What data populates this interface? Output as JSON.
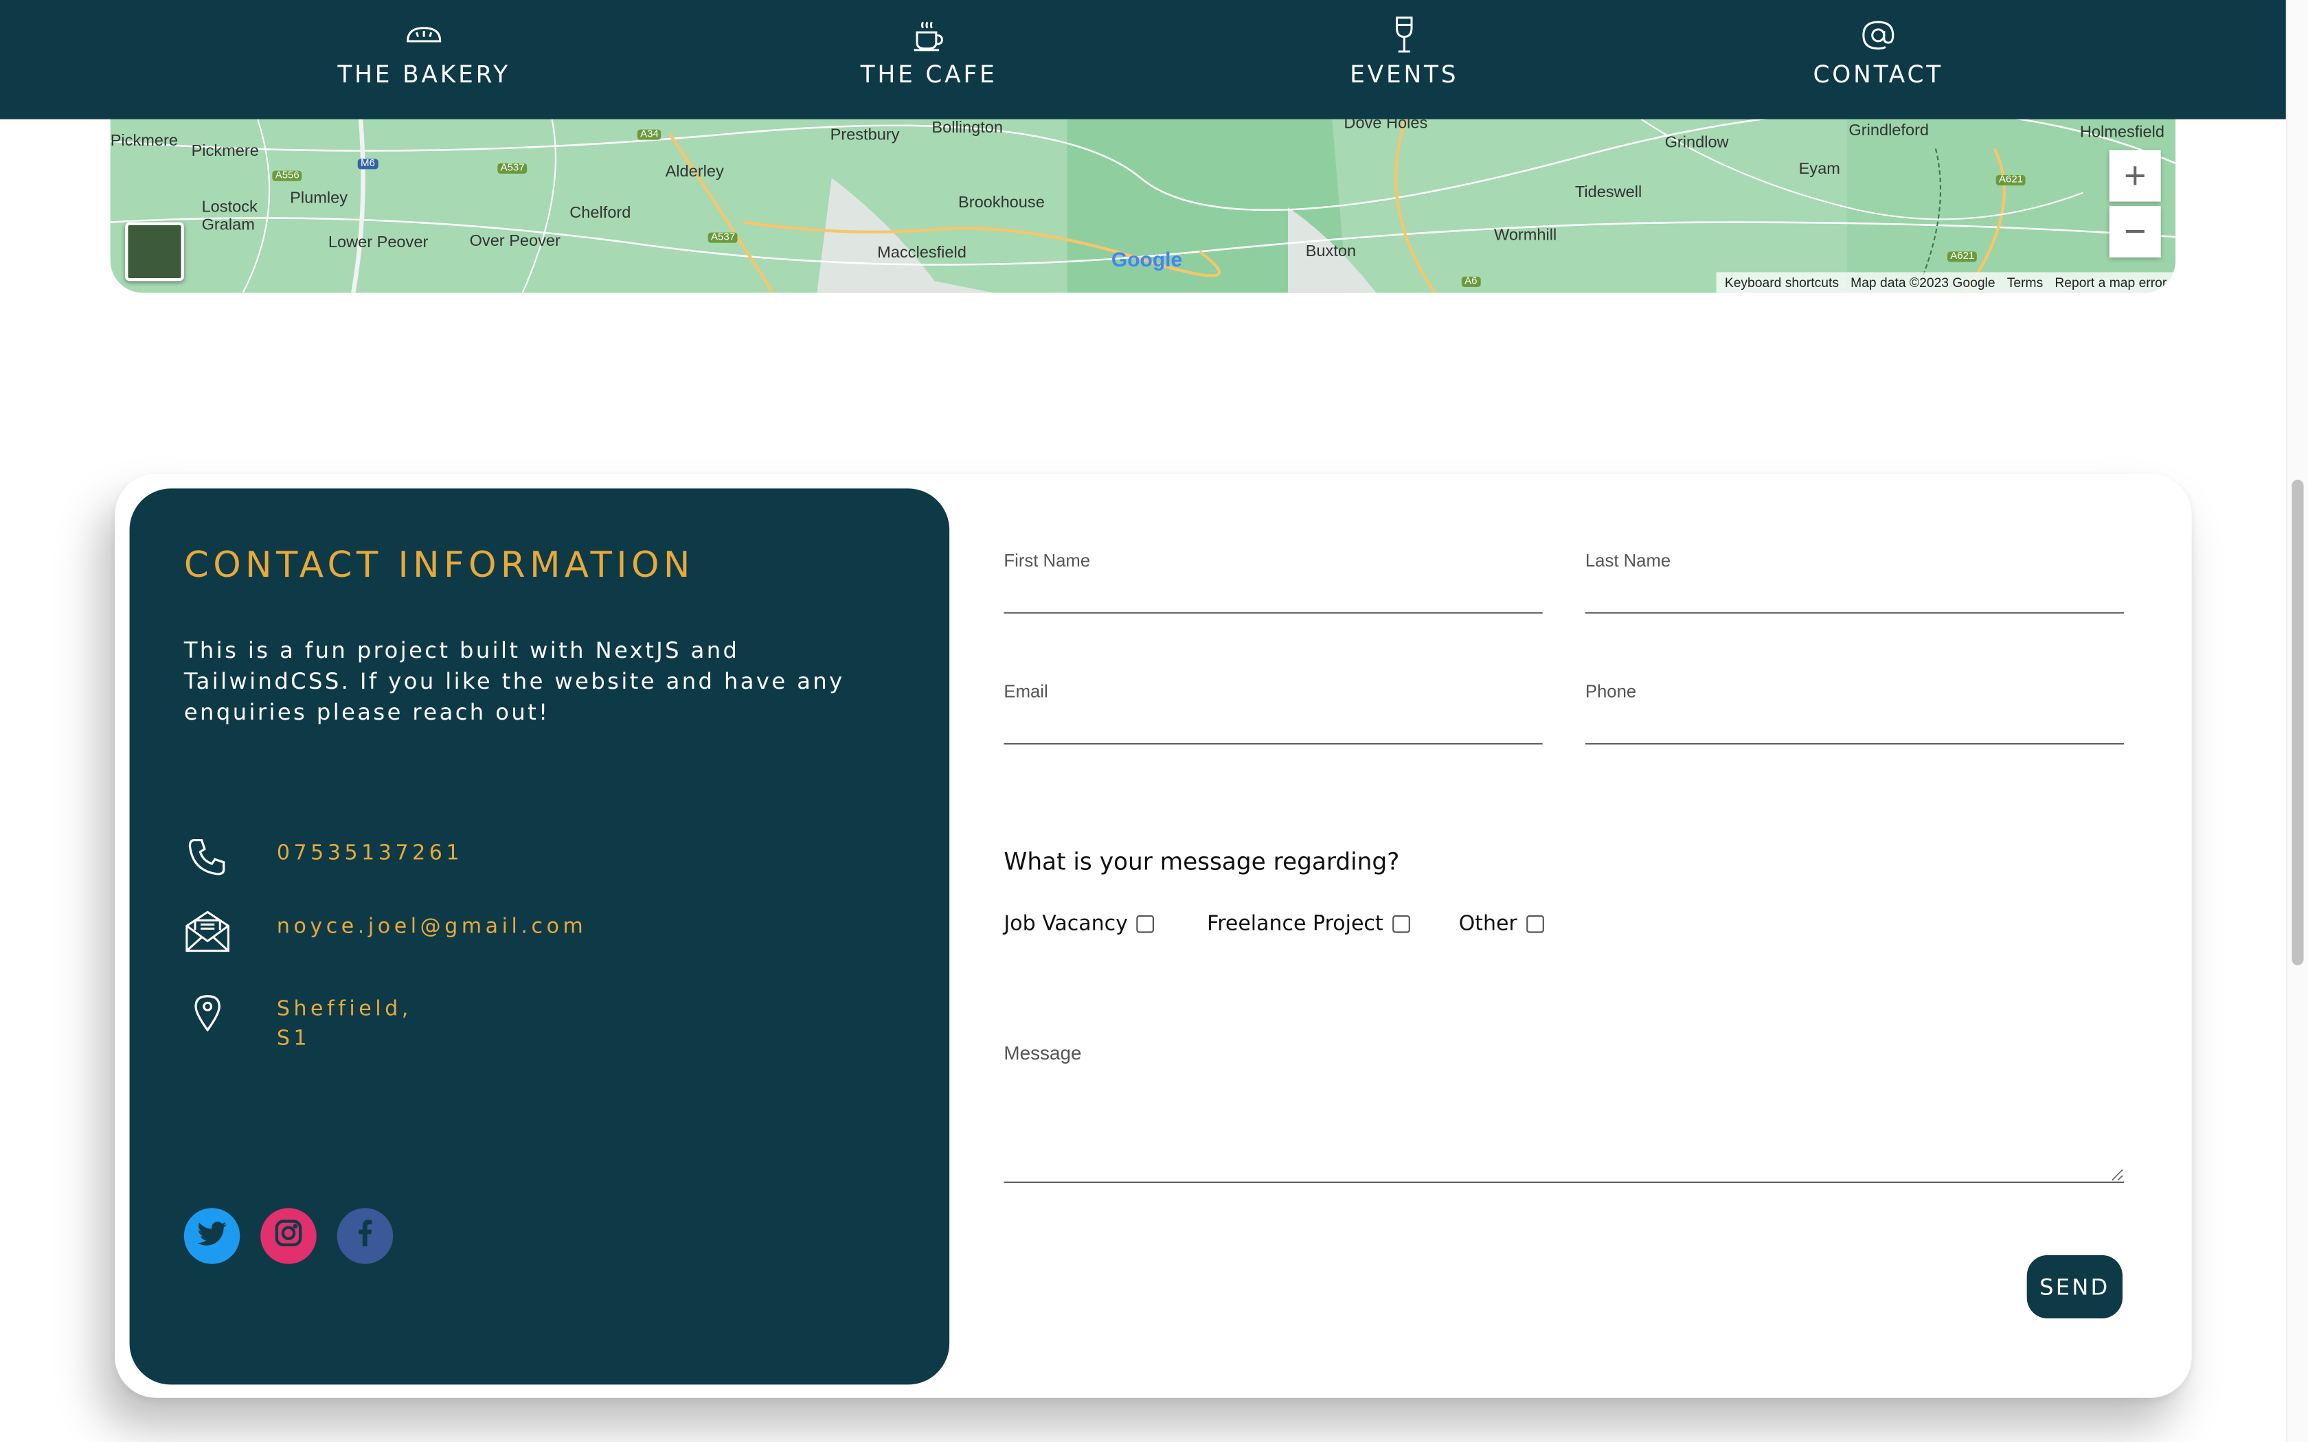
{
  "nav": {
    "items": [
      {
        "label": "THE BAKERY",
        "icon": "bread-icon"
      },
      {
        "label": "THE CAFE",
        "icon": "coffee-cup-icon"
      },
      {
        "label": "EVENTS",
        "icon": "wine-glass-icon"
      },
      {
        "label": "CONTACT",
        "icon": "at-sign-icon"
      }
    ]
  },
  "map": {
    "towns": [
      "Pickmere",
      "Lostock Gralam",
      "Plumley",
      "Lower Peover",
      "Over Peover",
      "Chelford",
      "Alderley",
      "Prestbury",
      "Bollington",
      "Brookhouse",
      "Macclesfield",
      "Dove Holes",
      "Buxton",
      "Wormhill",
      "Tideswell",
      "Grindlow",
      "Eyam",
      "Grindleford",
      "Holmesfield"
    ],
    "roads": [
      "A556",
      "M6",
      "A537",
      "A34",
      "A537",
      "A6",
      "A621",
      "A621"
    ],
    "zoom_in": "+",
    "zoom_out": "−",
    "attribution": [
      "Keyboard shortcuts",
      "Map data ©2023 Google",
      "Terms",
      "Report a map error"
    ],
    "logo": "Google"
  },
  "contact": {
    "title": "CONTACT INFORMATION",
    "description": "This is a fun project built with NextJS and TailwindCSS. If you like the website and have any enquiries please reach out!",
    "phone": "07535137261",
    "email": "noyce.joel@gmail.com",
    "address": "Sheffield,\nS1",
    "social": [
      "twitter-icon",
      "instagram-icon",
      "facebook-icon"
    ]
  },
  "form": {
    "first_name": "First Name",
    "last_name": "Last Name",
    "email": "Email",
    "phone": "Phone",
    "question": "What is your message regarding?",
    "options": [
      "Job Vacancy",
      "Freelance Project",
      "Other"
    ],
    "message": "Message",
    "send": "SEND"
  },
  "colors": {
    "primary": "#0e3a48",
    "accent": "#e9a93a",
    "twitter": "#1d9bf0",
    "instagram": "#e1306c",
    "facebook": "#3b5998"
  }
}
